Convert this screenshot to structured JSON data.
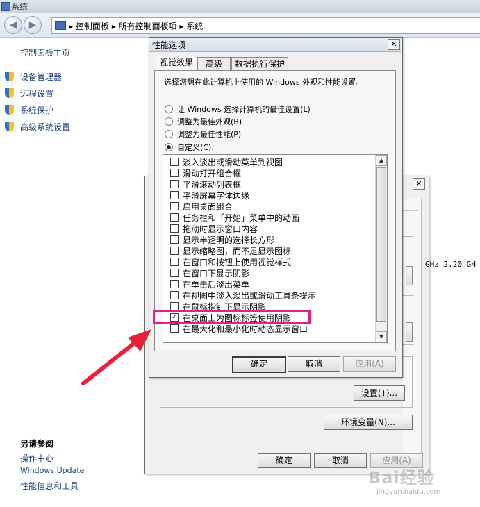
{
  "window": {
    "title": "系统"
  },
  "address": {
    "crumb_1": "控制面板",
    "crumb_2": "所有控制面板项",
    "crumb_3": "系统",
    "separator": "▸",
    "back_icon": "back-arrow-icon",
    "forward_icon": "forward-arrow-icon"
  },
  "left_panel": {
    "home": "控制面板主页",
    "links": [
      {
        "label": "设备管理器",
        "icon": "uac-shield-icon"
      },
      {
        "label": "远程设置",
        "icon": "uac-shield-icon"
      },
      {
        "label": "系统保护",
        "icon": "uac-shield-icon"
      },
      {
        "label": "高级系统设置",
        "icon": "uac-shield-icon"
      }
    ],
    "see_also_title": "另请参阅",
    "see_also": [
      "操作中心",
      "Windows Update",
      "性能信息和工具"
    ]
  },
  "background_info": {
    "cpu_fragment": "GHz  2.20 GH"
  },
  "system_properties": {
    "settings_button": "设置(T)...",
    "env_vars_button": "环境变量(N)...",
    "ok": "确定",
    "cancel": "取消",
    "apply": "应用(A)"
  },
  "perf_dialog": {
    "title": "性能选项",
    "tabs": [
      "视觉效果",
      "高级",
      "数据执行保护"
    ],
    "description": "选择您想在此计算机上使用的 Windows 外观和性能设置。",
    "radios": [
      {
        "label": "让 Windows 选择计算机的最佳设置(L)",
        "selected": false
      },
      {
        "label": "调整为最佳外观(B)",
        "selected": false
      },
      {
        "label": "调整为最佳性能(P)",
        "selected": false
      },
      {
        "label": "自定义(C):",
        "selected": true
      }
    ],
    "options": [
      {
        "label": "淡入淡出或滑动菜单到视图",
        "checked": false
      },
      {
        "label": "滑动打开组合框",
        "checked": false
      },
      {
        "label": "平滑滚动列表框",
        "checked": false
      },
      {
        "label": "平滑屏幕字体边缘",
        "checked": false
      },
      {
        "label": "启用桌面组合",
        "checked": false
      },
      {
        "label": "任务栏和「开始」菜单中的动画",
        "checked": false
      },
      {
        "label": "拖动时显示窗口内容",
        "checked": false
      },
      {
        "label": "显示半透明的选择长方形",
        "checked": false
      },
      {
        "label": "显示缩略图，而不是显示图标",
        "checked": false
      },
      {
        "label": "在窗口和按钮上使用视觉样式",
        "checked": false
      },
      {
        "label": "在窗口下显示阴影",
        "checked": false
      },
      {
        "label": "在单击后淡出菜单",
        "checked": false
      },
      {
        "label": "在视图中淡入淡出或滑动工具条提示",
        "checked": false
      },
      {
        "label": "在鼠标指针下显示阴影",
        "checked": false
      },
      {
        "label": "在桌面上为图标标签使用阴影",
        "checked": true
      },
      {
        "label": "在最大化和最小化时动态显示窗口",
        "checked": false
      }
    ],
    "ok": "确定",
    "cancel": "取消",
    "apply": "应用(A)",
    "close_glyph": "✕",
    "check_glyph": "✓"
  },
  "annotation": {
    "highlight_color": "#e0218a",
    "arrow_color": "#e8203a"
  },
  "watermark": {
    "text": "Bai经验",
    "sub": "jingyan.baidu.com"
  }
}
